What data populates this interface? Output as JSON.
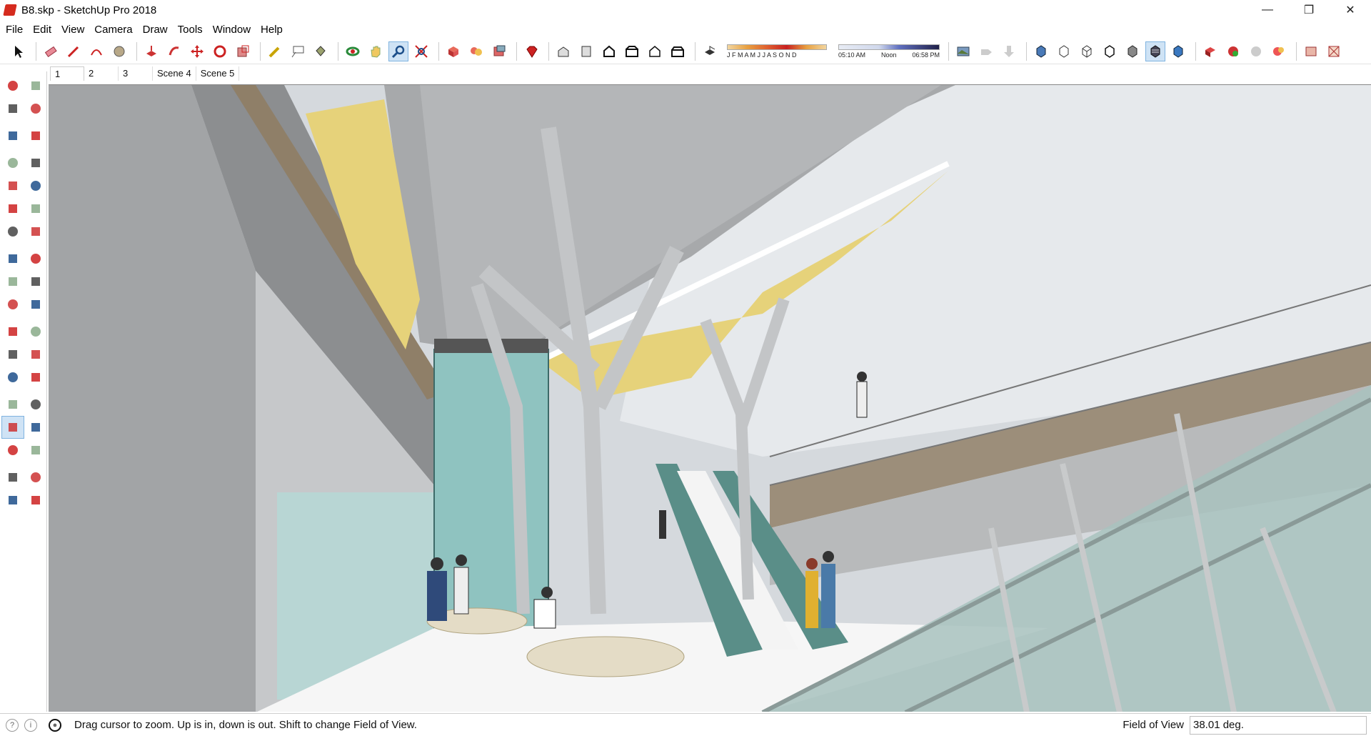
{
  "window": {
    "title": "B8.skp - SketchUp Pro 2018",
    "controls": {
      "minimize": "—",
      "restore": "❐",
      "close": "✕"
    }
  },
  "menu": [
    "File",
    "Edit",
    "View",
    "Camera",
    "Draw",
    "Tools",
    "Window",
    "Help"
  ],
  "toolbar": {
    "sun": {
      "months": "J F M A M J J A S O N D",
      "time_start": "05:10 AM",
      "time_mid": "Noon",
      "time_end": "06:58 PM"
    }
  },
  "scenes": [
    "1",
    "2",
    "3",
    "Scene 4",
    "Scene 5"
  ],
  "active_scene": "1",
  "palette_tools": [
    "select-tool",
    "make-component-tool",
    "paint-bucket-tool",
    "eraser-tool",
    "line-tool",
    "freehand-tool",
    "rectangle-tool",
    "rotated-rectangle-tool",
    "circle-tool",
    "polygon-tool",
    "arc-tool",
    "two-point-arc-tool",
    "three-point-arc-tool",
    "pie-tool",
    "move-tool",
    "push-pull-tool",
    "rotate-tool",
    "follow-me-tool",
    "scale-tool",
    "offset-tool",
    "tape-measure-tool",
    "dimension-tool",
    "protractor-tool",
    "text-tool",
    "axes-tool",
    "3d-text-tool",
    "orbit-tool",
    "pan-tool",
    "zoom-tool",
    "zoom-window-tool",
    "zoom-extents-tool",
    "previous-view-tool",
    "position-camera-tool",
    "look-around-tool",
    "walk-tool",
    "section-plane-tool"
  ],
  "status": {
    "message": "Drag cursor to zoom.  Up is in, down is out. Shift to change Field of View.",
    "measure_label": "Field of View",
    "measure_value": "38.01 deg."
  },
  "colors": {
    "sketchup_red": "#d52b1e",
    "active_blue": "#cfe3f5",
    "roof_yellow": "#e6d27a",
    "glass_teal": "#8fc3c0"
  }
}
